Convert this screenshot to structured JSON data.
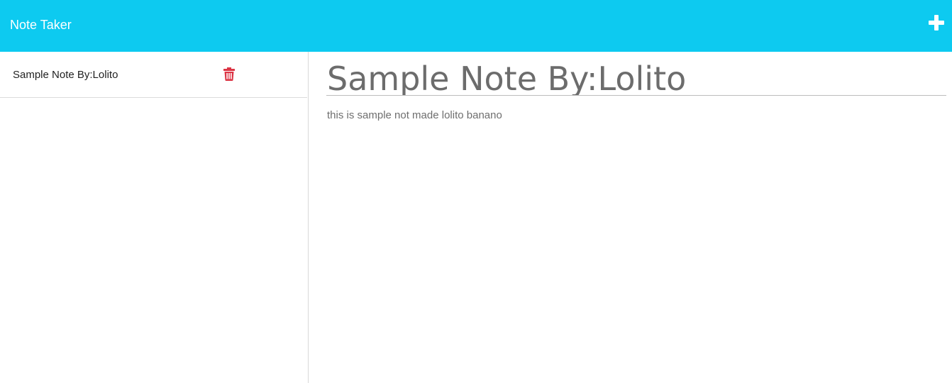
{
  "navbar": {
    "brand": "Note Taker",
    "new_note_icon": "plus-icon",
    "background_color": "#0dcaf0"
  },
  "sidebar": {
    "notes": [
      {
        "title": "Sample Note By:Lolito",
        "delete_icon": "trash-icon",
        "delete_icon_color": "#dc3545"
      }
    ]
  },
  "editor": {
    "title_value": "Sample Note By:Lolito",
    "body_value": "this is sample not made lolito banano"
  }
}
